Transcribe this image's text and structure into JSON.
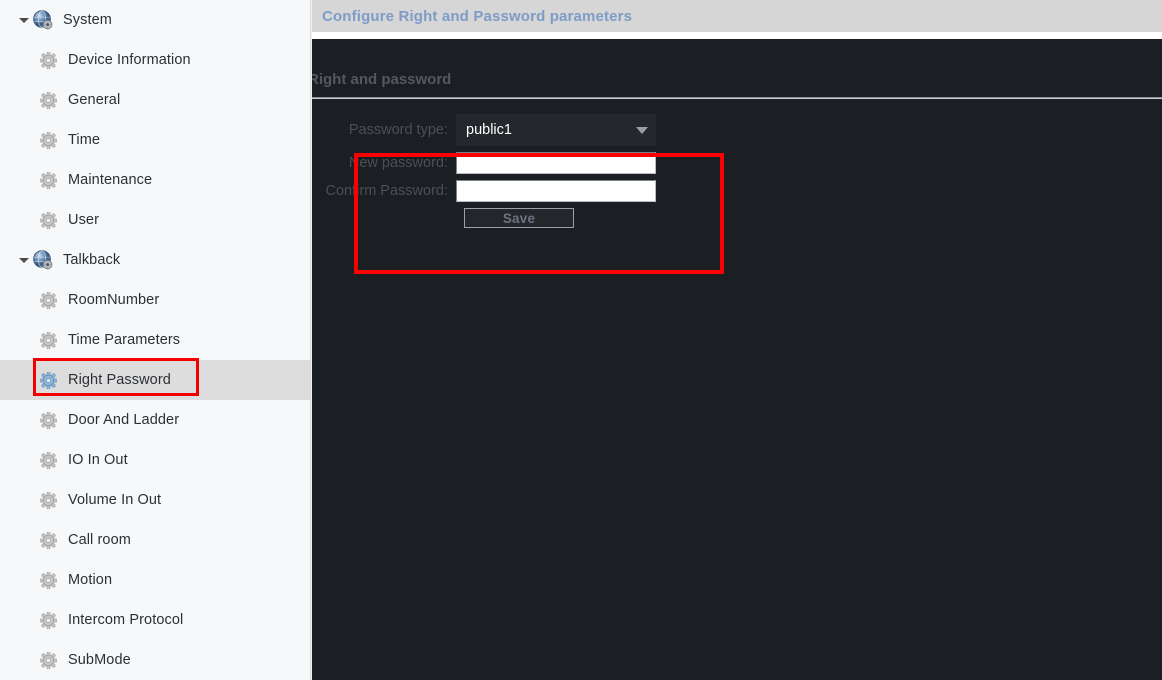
{
  "sidebar": {
    "groups": [
      {
        "label": "System",
        "icon": "globe-gear-icon",
        "expanded": true,
        "items": [
          {
            "label": "Device Information",
            "icon": "gear-icon",
            "selected": false
          },
          {
            "label": "General",
            "icon": "gear-icon",
            "selected": false
          },
          {
            "label": "Time",
            "icon": "gear-icon",
            "selected": false
          },
          {
            "label": "Maintenance",
            "icon": "gear-icon",
            "selected": false
          },
          {
            "label": "User",
            "icon": "gear-icon",
            "selected": false
          }
        ]
      },
      {
        "label": "Talkback",
        "icon": "globe-gear-icon",
        "expanded": true,
        "items": [
          {
            "label": "RoomNumber",
            "icon": "gear-icon",
            "selected": false
          },
          {
            "label": "Time Parameters",
            "icon": "gear-icon",
            "selected": false
          },
          {
            "label": "Right Password",
            "icon": "gear-icon",
            "selected": true
          },
          {
            "label": "Door And Ladder",
            "icon": "gear-icon",
            "selected": false
          },
          {
            "label": "IO In Out",
            "icon": "gear-icon",
            "selected": false
          },
          {
            "label": "Volume In Out",
            "icon": "gear-icon",
            "selected": false
          },
          {
            "label": "Call room",
            "icon": "gear-icon",
            "selected": false
          },
          {
            "label": "Motion",
            "icon": "gear-icon",
            "selected": false
          },
          {
            "label": "Intercom Protocol",
            "icon": "gear-icon",
            "selected": false
          },
          {
            "label": "SubMode",
            "icon": "gear-icon",
            "selected": false
          }
        ]
      }
    ]
  },
  "header": {
    "title": "Configure Right and Password parameters"
  },
  "content": {
    "section_title": "Right and password",
    "form": {
      "password_type": {
        "label": "Password type:",
        "value": "public1",
        "options": [
          "public1"
        ],
        "caret_icon": "chevron-down-icon"
      },
      "new_password": {
        "label": "New password:",
        "value": "",
        "placeholder": ""
      },
      "confirm_password": {
        "label": "Confirm Password:",
        "value": "",
        "placeholder": ""
      },
      "save_label": "Save"
    }
  },
  "annotations": {
    "highlight_color": "#fb0000",
    "sidebar_highlight_target": "Right Password",
    "form_highlight_target": "password fields group"
  },
  "colors": {
    "accent_title": "#7d9cc6",
    "panel_background": "#1b1e22",
    "sidebar_background": "#f7f8f9",
    "titlebar_background": "#d6d6d6",
    "selected_row": "#dddddd",
    "highlight": "#fb0000"
  }
}
